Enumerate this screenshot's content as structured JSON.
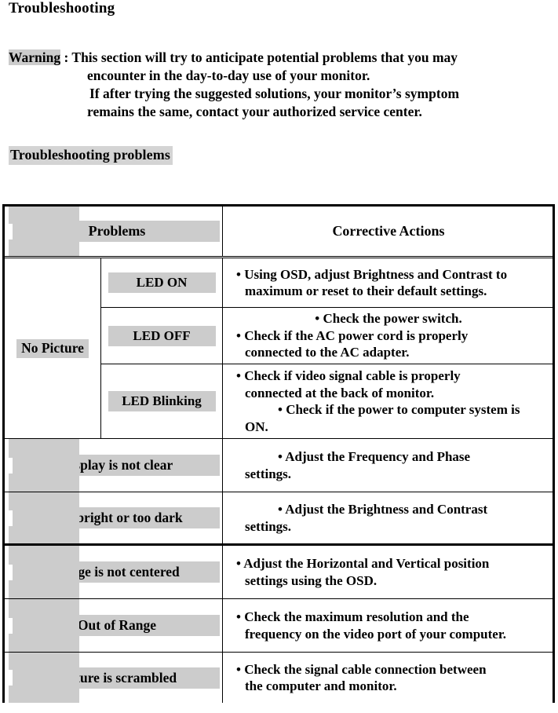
{
  "document": {
    "title": "Troubleshooting",
    "warning": {
      "label": "Warning",
      "separator": " : ",
      "line1": "This section will try to anticipate potential problems that you may",
      "line2": "encounter in the day-to-day use of your monitor.",
      "line3": "If after trying the suggested solutions, your monitor’s symptom",
      "line4": "remains the same, contact your authorized service center."
    },
    "section_heading": "Troubleshooting problems"
  },
  "table": {
    "header": {
      "problems": "Problems",
      "corrective_actions": "Corrective Actions"
    },
    "no_picture_group": {
      "label": "No Picture",
      "rows": [
        {
          "led": "LED ON",
          "actions": [
            {
              "style": "hang",
              "text": "• Using OSD, adjust Brightness and Contrast to"
            },
            {
              "style": "plain",
              "text": "maximum or reset to their default settings."
            }
          ]
        },
        {
          "led": "LED OFF",
          "actions": [
            {
              "style": "center",
              "text": "• Check the power switch."
            },
            {
              "style": "hang",
              "text": "• Check if the AC power cord is properly"
            },
            {
              "style": "plain",
              "text": "connected to the AC adapter."
            }
          ]
        },
        {
          "led": "LED Blinking",
          "actions": [
            {
              "style": "hang",
              "text": "• Check if video signal cable is properly"
            },
            {
              "style": "plain",
              "text": "connected at the back of monitor."
            },
            {
              "style": "indent",
              "text": "• Check if the power to computer system is"
            },
            {
              "style": "plain",
              "text": "ON."
            }
          ]
        }
      ]
    },
    "simple_rows": [
      {
        "problem": "Display is not clear",
        "actions": [
          {
            "style": "indent",
            "text": "• Adjust the Frequency and Phase"
          },
          {
            "style": "plain",
            "text": "settings."
          }
        ]
      },
      {
        "problem": "Too bright or too dark",
        "actions": [
          {
            "style": "indent",
            "text": "• Adjust the Brightness and Contrast"
          },
          {
            "style": "plain",
            "text": "settings."
          }
        ]
      },
      {
        "problem": "Image is not centered",
        "actions": [
          {
            "style": "hang",
            "text": "• Adjust the Horizontal and Vertical position"
          },
          {
            "style": "plain",
            "text": "settings using the OSD."
          }
        ]
      },
      {
        "problem": "Out of Range",
        "actions": [
          {
            "style": "hang",
            "text": "• Check the maximum resolution and the"
          },
          {
            "style": "plain",
            "text": "frequency on the video port of your computer."
          }
        ]
      },
      {
        "problem": "Picture is scrambled",
        "actions": [
          {
            "style": "hang",
            "text": "• Check the signal cable connection between"
          },
          {
            "style": "plain",
            "text": "the computer and monitor."
          }
        ]
      }
    ]
  },
  "colors": {
    "highlight": "#cccccc",
    "heading_highlight": "#d4d4d4",
    "border": "#000000",
    "page_background": "#ffffff"
  }
}
